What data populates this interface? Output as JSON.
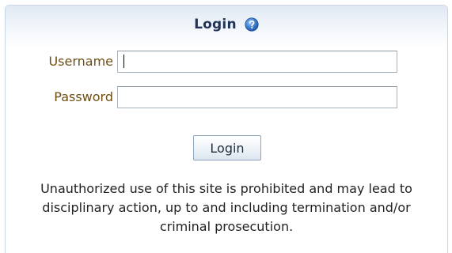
{
  "panel": {
    "title": "Login",
    "help_icon": "help-question-icon"
  },
  "form": {
    "username_label": "Username",
    "username_value": "",
    "password_label": "Password",
    "password_value": "",
    "submit_label": "Login"
  },
  "notice": {
    "text": "Unauthorized use of this site is prohibited and may lead to disciplinary action, up to and including termination and/or criminal prosecution."
  },
  "colors": {
    "title": "#20345a",
    "label": "#6f4e12",
    "border": "#c9d6e4",
    "help_icon": "#3f7fd0"
  }
}
